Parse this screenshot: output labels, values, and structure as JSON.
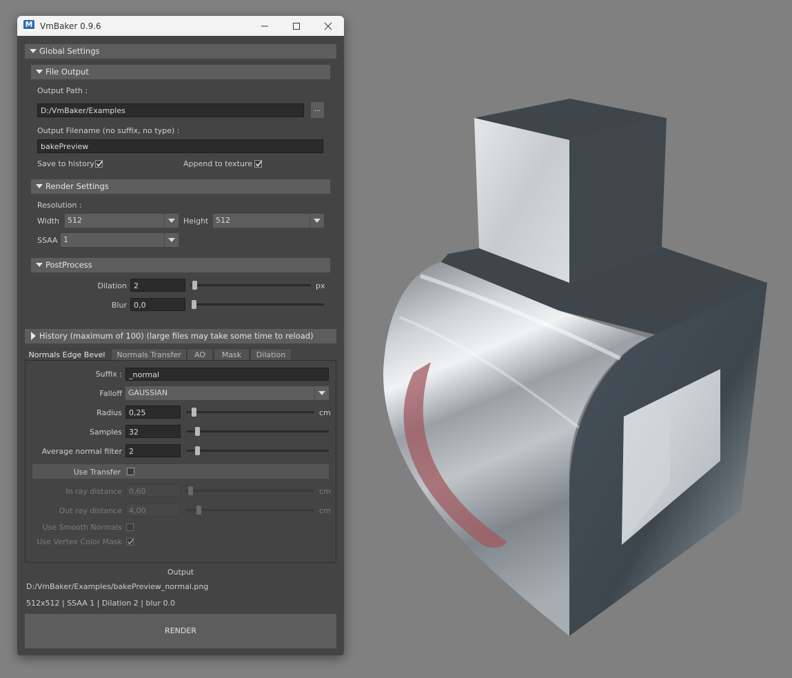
{
  "window": {
    "title": "VmBaker 0.9.6"
  },
  "global_settings": {
    "label": "Global Settings"
  },
  "file_output": {
    "label": "File Output",
    "output_path_label": "Output Path :",
    "output_path_value": "D:/VmBaker/Examples",
    "browse_label": "...",
    "filename_label": "Output Filename (no suffix, no type) :",
    "filename_value": "bakePreview",
    "save_history_label": "Save to history",
    "save_history_checked": true,
    "append_texture_label": "Append to texture",
    "append_texture_checked": true
  },
  "render_settings": {
    "label": "Render Settings",
    "resolution_label": "Resolution :",
    "width_label": "Width",
    "width_value": "512",
    "height_label": "Height",
    "height_value": "512",
    "ssaa_label": "SSAA",
    "ssaa_value": "1"
  },
  "postprocess": {
    "label": "PostProcess",
    "dilation_label": "Dilation",
    "dilation_value": "2",
    "dilation_unit": "px",
    "blur_label": "Blur",
    "blur_value": "0,0"
  },
  "history": {
    "label": "History (maximum of 100) (large files may take some time to reload)"
  },
  "tabs": [
    {
      "label": "Normals Edge Bevel",
      "active": true
    },
    {
      "label": "Normals Transfer",
      "active": false
    },
    {
      "label": "AO",
      "active": false
    },
    {
      "label": "Mask",
      "active": false
    },
    {
      "label": "Dilation",
      "active": false
    }
  ],
  "normals_edge_bevel": {
    "suffix_label": "Suffix :",
    "suffix_value": "_normal",
    "falloff_label": "Falloff",
    "falloff_value": "GAUSSIAN",
    "radius_label": "Radius",
    "radius_value": "0,25",
    "radius_unit": "cm",
    "samples_label": "Samples",
    "samples_value": "32",
    "avg_filter_label": "Average normal filter",
    "avg_filter_value": "2",
    "use_transfer_label": "Use Transfer",
    "use_transfer_checked": false,
    "in_ray_label": "In ray distance",
    "in_ray_value": "0,60",
    "in_ray_unit": "cm",
    "out_ray_label": "Out ray distance",
    "out_ray_value": "4,00",
    "out_ray_unit": "cm",
    "smooth_normals_label": "Use Smooth Normals",
    "smooth_normals_checked": false,
    "vertex_color_label": "Use Vertex Color Mask",
    "vertex_color_checked": true
  },
  "output": {
    "heading": "Output",
    "path": "D:/VmBaker/Examples/bakePreview_normal.png",
    "summary": "512x512 | SSAA 1 | Dilation 2 | blur 0.0"
  },
  "render_button": {
    "label": "RENDER"
  },
  "colors": {
    "panel_bg": "#444444",
    "section_header": "#5d5d5d",
    "input_bg": "#2b2b2b",
    "viewport_bg": "#808080",
    "model_dark": "#3f474b"
  }
}
